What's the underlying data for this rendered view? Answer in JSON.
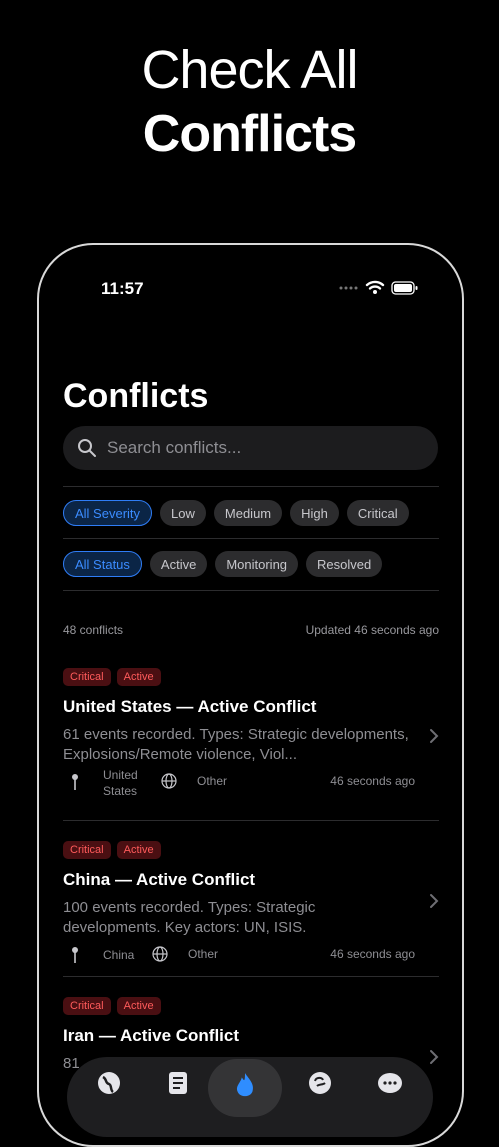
{
  "promo": {
    "line1": "Check All",
    "line2": "Conflicts"
  },
  "status_bar": {
    "time": "11:57"
  },
  "page": {
    "title": "Conflicts"
  },
  "search": {
    "placeholder": "Search conflicts..."
  },
  "severity_filters": [
    "All Severity",
    "Low",
    "Medium",
    "High",
    "Critical"
  ],
  "status_filters": [
    "All Status",
    "Active",
    "Monitoring",
    "Resolved"
  ],
  "summary": {
    "count": "48 conflicts",
    "updated": "Updated 46 seconds ago"
  },
  "conflicts": [
    {
      "badges": [
        "Critical",
        "Active"
      ],
      "title": "United States — Active Conflict",
      "description": "61 events recorded. Types: Strategic developments, Explosions/Remote violence, Viol...",
      "location": "United States",
      "type": "Other",
      "time_ago": "46 seconds ago"
    },
    {
      "badges": [
        "Critical",
        "Active"
      ],
      "title": "China — Active Conflict",
      "description": "100 events recorded. Types: Strategic developments. Key actors: UN, ISIS.",
      "location": "China",
      "type": "Other",
      "time_ago": "46 seconds ago"
    },
    {
      "badges": [
        "Critical",
        "Active"
      ],
      "title": "Iran — Active Conflict",
      "description": "81"
    }
  ],
  "tabs": [
    "globe-icon",
    "list-icon",
    "flame-icon",
    "brain-icon",
    "chat-icon"
  ],
  "colors": {
    "accent": "#2f7df6",
    "critical": "#ff5b5b",
    "background": "#000000"
  }
}
